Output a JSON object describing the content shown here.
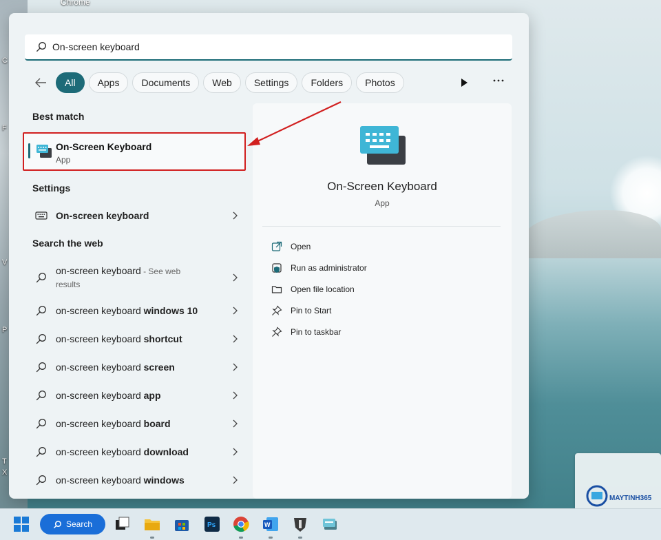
{
  "desktop": {
    "top_label": "Chrome",
    "edge_letters": [
      "C",
      "F",
      "V",
      "P",
      "T",
      "X"
    ]
  },
  "search": {
    "query": "On-screen keyboard"
  },
  "filters": {
    "back_icon": "arrow-left-icon",
    "chips": [
      "All",
      "Apps",
      "Documents",
      "Web",
      "Settings",
      "Folders",
      "Photos"
    ],
    "active": "All"
  },
  "best_match": {
    "heading": "Best match",
    "title": "On-Screen Keyboard",
    "subtitle": "App"
  },
  "settings": {
    "heading": "Settings",
    "item": "On-screen keyboard"
  },
  "web": {
    "heading": "Search the web",
    "first": {
      "prefix": "on-screen keyboard",
      "suffix": " - See web",
      "line2": "results"
    },
    "items": [
      {
        "prefix": "on-screen keyboard",
        "bold": "windows 10"
      },
      {
        "prefix": "on-screen keyboard",
        "bold": "shortcut"
      },
      {
        "prefix": "on-screen keyboard",
        "bold": "screen"
      },
      {
        "prefix": "on-screen keyboard",
        "bold": "app"
      },
      {
        "prefix": "on-screen keyboard",
        "bold": "board"
      },
      {
        "prefix": "on-screen keyboard",
        "bold": "download"
      },
      {
        "prefix": "on-screen keyboard",
        "bold": "windows"
      }
    ]
  },
  "details": {
    "title": "On-Screen Keyboard",
    "subtitle": "App",
    "actions": [
      "Open",
      "Run as administrator",
      "Open file location",
      "Pin to Start",
      "Pin to taskbar"
    ]
  },
  "taskbar": {
    "search_label": "Search"
  },
  "watermark": {
    "brand": "MAYTINH365"
  },
  "colors": {
    "accent": "#1d6b78",
    "highlight_border": "#d11f1f",
    "taskbar_search": "#1a6ed8"
  }
}
